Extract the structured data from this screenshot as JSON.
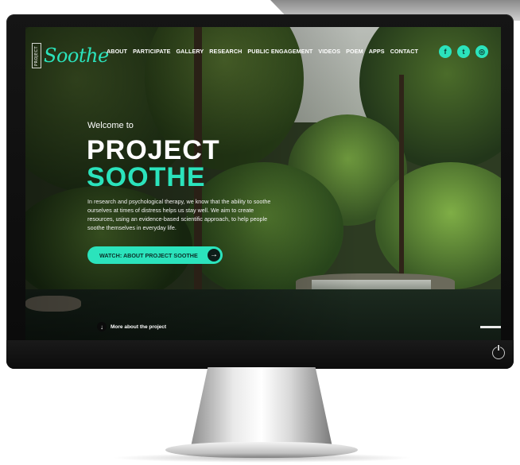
{
  "brand": {
    "small_label": "PROJECT",
    "name": "Soothe"
  },
  "nav": {
    "items": [
      "ABOUT",
      "PARTICIPATE",
      "GALLERY",
      "RESEARCH",
      "PUBLIC ENGAGEMENT",
      "VIDEOS",
      "POEM",
      "APPS",
      "CONTACT"
    ]
  },
  "social": [
    {
      "icon": "facebook-icon",
      "glyph": "f"
    },
    {
      "icon": "twitter-icon",
      "glyph": "t"
    },
    {
      "icon": "instagram-icon",
      "glyph": "◎"
    }
  ],
  "hero": {
    "welcome": "Welcome to",
    "title_line1": "PROJECT",
    "title_line2": "SOOTHE",
    "intro": "In research and psychological therapy, we know that the ability to soothe ourselves at times of distress helps us stay well. We aim to create resources, using an evidence-based scientific approach, to help people soothe themselves in everyday life.",
    "cta_label": "WATCH: ABOUT PROJECT SOOTHE",
    "more_label": "More about the project"
  },
  "colors": {
    "accent": "#2be3bc",
    "bezel": "#0f0f0f"
  }
}
